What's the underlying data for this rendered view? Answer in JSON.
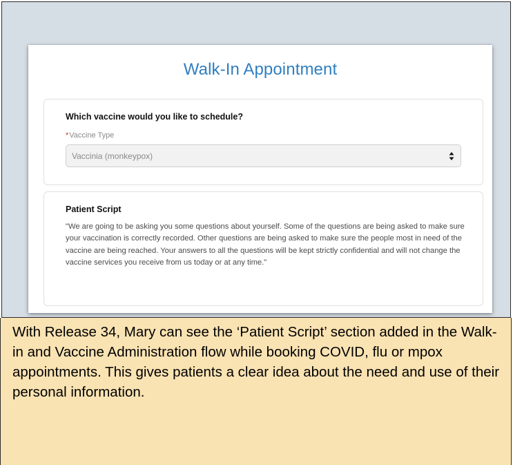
{
  "card": {
    "title": "Walk-In Appointment"
  },
  "vaccine_section": {
    "question": "Which vaccine would you like to schedule?",
    "field_label": "Vaccine Type",
    "required_marker": "*",
    "selected_value": "Vaccinia (monkeypox)"
  },
  "script_section": {
    "heading": "Patient Script",
    "text": "\"We are going to be asking you some questions about yourself. Some of the questions are being asked to make sure your vaccination is correctly recorded. Other questions are being asked to make sure the people most in need of the vaccine are being reached. Your answers to all the questions will be kept strictly confidential and will not change the vaccine services you receive from us today or at any time.\""
  },
  "caption": {
    "text": "With Release 34, Mary can see the ‘Patient Script’ section added in the Walk-in and Vaccine Administration flow while booking COVID, flu or mpox appointments. This gives patients a clear idea about the need and use of their personal information."
  },
  "colors": {
    "title_blue": "#2f7fc1",
    "background_gray": "#d5dde5",
    "caption_background": "#fae3b3",
    "required_red": "#c2302a"
  },
  "icons": {
    "select_arrows": "up-down-arrows-icon"
  }
}
